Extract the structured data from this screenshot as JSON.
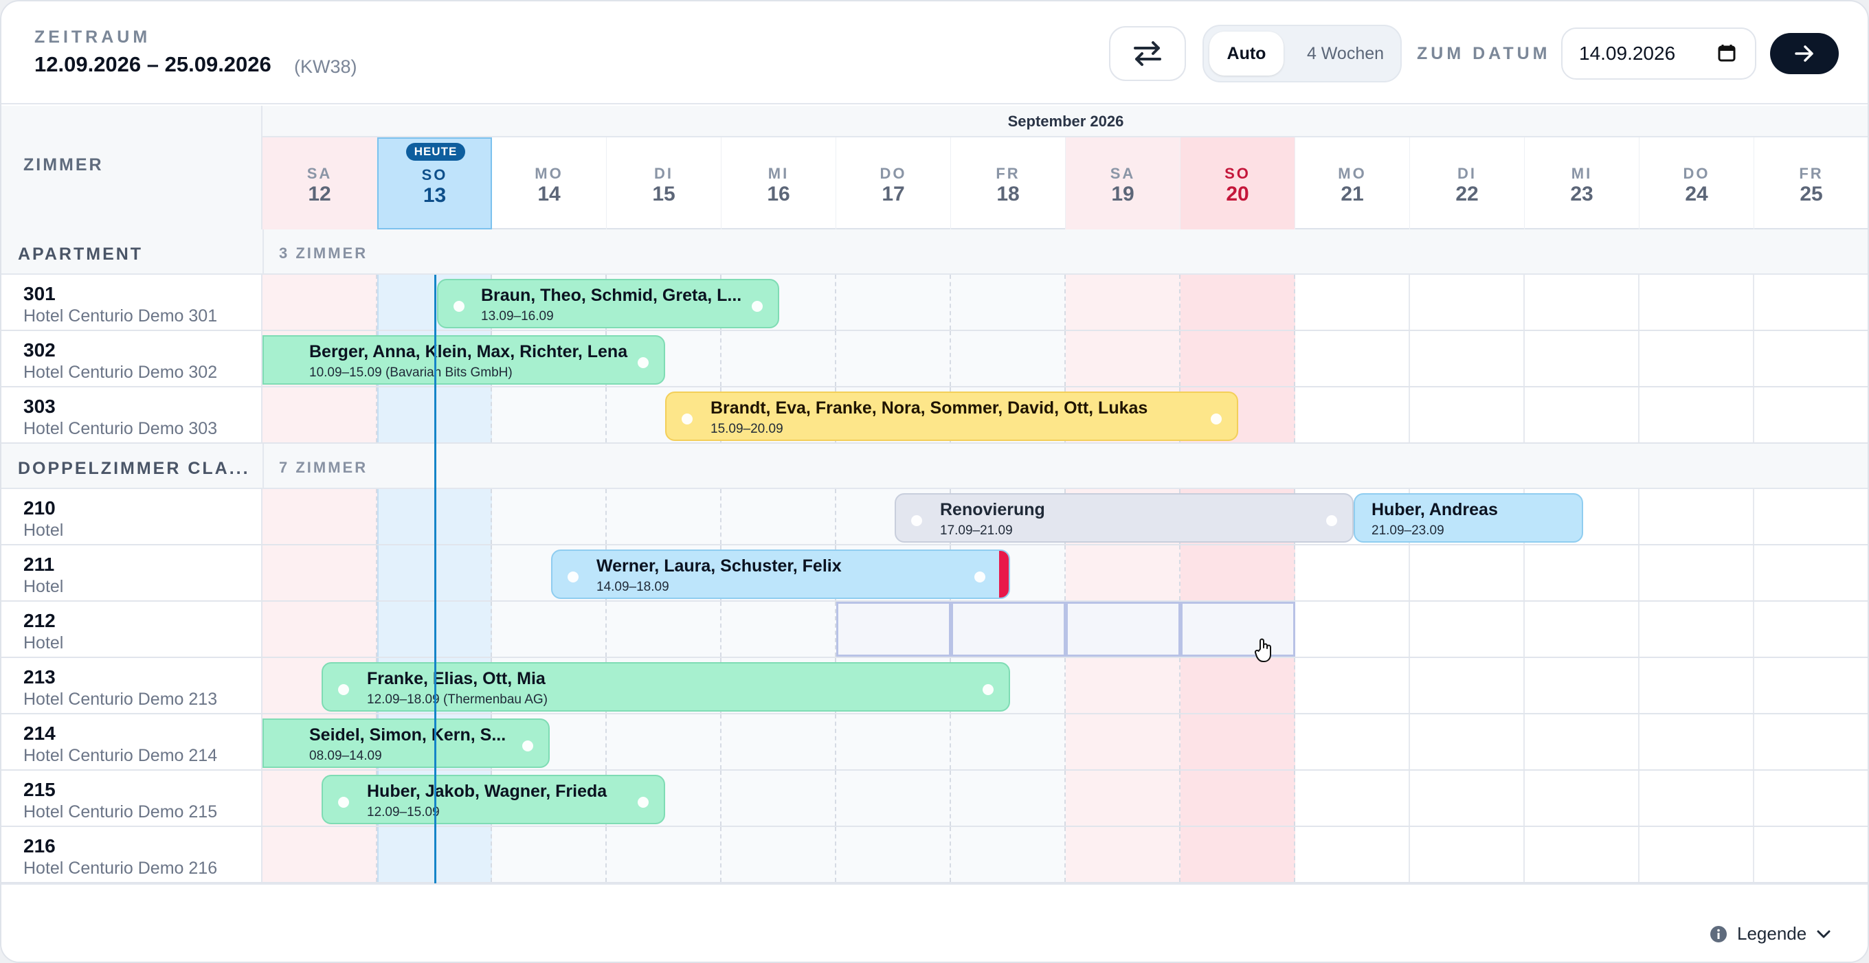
{
  "header": {
    "period_label": "ZEITRAUM",
    "period_range": "12.09.2026 – 25.09.2026",
    "week": "(KW38)",
    "view_modes": [
      "Auto",
      "4 Wochen"
    ],
    "active_mode": "Auto",
    "goto_label": "ZUM DATUM",
    "date_value": "14.09.2026"
  },
  "calendar": {
    "month": "September 2026",
    "room_column_label": "ZIMMER",
    "today_badge": "HEUTE",
    "days": [
      {
        "name": "SA",
        "date": "12"
      },
      {
        "name": "SO",
        "date": "13"
      },
      {
        "name": "MO",
        "date": "14"
      },
      {
        "name": "DI",
        "date": "15"
      },
      {
        "name": "MI",
        "date": "16"
      },
      {
        "name": "DO",
        "date": "17"
      },
      {
        "name": "FR",
        "date": "18"
      },
      {
        "name": "SA",
        "date": "19"
      },
      {
        "name": "SO",
        "date": "20"
      },
      {
        "name": "MO",
        "date": "21"
      },
      {
        "name": "DI",
        "date": "22"
      },
      {
        "name": "MI",
        "date": "23"
      },
      {
        "name": "DO",
        "date": "24"
      },
      {
        "name": "FR",
        "date": "25"
      }
    ]
  },
  "groups": [
    {
      "name": "APARTMENT",
      "count": "3 ZIMMER",
      "rooms": [
        {
          "number": "301",
          "name": "Hotel Centurio Demo 301"
        },
        {
          "number": "302",
          "name": "Hotel Centurio Demo 302"
        },
        {
          "number": "303",
          "name": "Hotel Centurio Demo 303"
        }
      ]
    },
    {
      "name": "DOPPELZIMMER CLA...",
      "count": "7 ZIMMER",
      "rooms": [
        {
          "number": "210",
          "name": "Hotel"
        },
        {
          "number": "211",
          "name": "Hotel"
        },
        {
          "number": "212",
          "name": "Hotel"
        },
        {
          "number": "213",
          "name": "Hotel Centurio Demo 213"
        },
        {
          "number": "214",
          "name": "Hotel Centurio Demo 214"
        },
        {
          "number": "215",
          "name": "Hotel Centurio Demo 215"
        },
        {
          "number": "216",
          "name": "Hotel Centurio Demo 216"
        }
      ]
    }
  ],
  "bookings": [
    {
      "room": "301",
      "guests": "Braun, Theo, Schmid, Greta, L...",
      "dates": "13.09–16.09",
      "color": "green"
    },
    {
      "room": "302",
      "guests": "Berger, Anna, Klein, Max, Richter, Lena",
      "dates": "10.09–15.09 (Bavarian Bits GmbH)",
      "color": "green"
    },
    {
      "room": "303",
      "guests": "Brandt, Eva, Franke, Nora, Sommer, David, Ott, Lukas",
      "dates": "15.09–20.09",
      "color": "yellow"
    },
    {
      "room": "210",
      "guests": "Renovierung",
      "dates": "17.09–21.09",
      "color": "gray"
    },
    {
      "room": "210",
      "guests": "Huber, Andreas",
      "dates": "21.09–23.09",
      "color": "blue"
    },
    {
      "room": "211",
      "guests": "Werner, Laura, Schuster, Felix",
      "dates": "14.09–18.09",
      "color": "blue"
    },
    {
      "room": "213",
      "guests": "Franke, Elias, Ott, Mia",
      "dates": "12.09–18.09 (Thermenbau AG)",
      "color": "green"
    },
    {
      "room": "214",
      "guests": "Seidel, Simon, Kern, S...",
      "dates": "08.09–14.09",
      "color": "green"
    },
    {
      "room": "215",
      "guests": "Huber, Jakob, Wagner, Frieda",
      "dates": "12.09–15.09",
      "color": "green"
    }
  ],
  "footer": {
    "legend_label": "Legende"
  },
  "colors": {
    "accent_dark": "#0b1628",
    "today": "#bfe3fb",
    "weekend": "#fcecef",
    "sunday": "#fde0e4",
    "booking_green": "#a7f0cf",
    "booking_yellow": "#fde68a",
    "booking_blue": "#bde5fb",
    "booking_gray": "#e3e6ef",
    "overdue_marker": "#e8194a"
  },
  "icons": [
    "swap-arrows-icon",
    "calendar-icon",
    "arrow-right-icon",
    "info-icon",
    "chevron-down-icon",
    "hand-pointer-icon"
  ]
}
